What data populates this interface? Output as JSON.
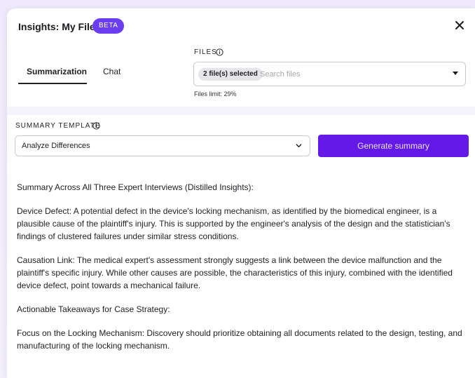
{
  "header": {
    "title": "Insights: My Files",
    "badge": "BETA",
    "close_icon": "close-icon"
  },
  "tabs": [
    {
      "label": "Summarization",
      "active": true
    },
    {
      "label": "Chat",
      "active": false
    }
  ],
  "files": {
    "label": "FILES",
    "selected_chip": "2 file(s) selected",
    "placeholder": "Search files",
    "limit_text": "Files limit: 29%",
    "limit_percent": 29
  },
  "template": {
    "label": "SUMMARY TEMPLATE",
    "selected": "Analyze Differences"
  },
  "actions": {
    "generate_label": "Generate summary"
  },
  "summary": {
    "paragraphs": [
      "Summary Across All Three Expert Interviews (Distilled Insights):",
      "Device Defect: A potential defect in the device's locking mechanism, as identified by the biomedical engineer, is a plausible cause of the plaintiff's injury. This is supported by the engineer's analysis of the design and the statistician's findings of clustered failures under similar stress conditions.",
      "Causation Link: The medical expert's assessment strongly suggests a link between the device malfunction and the plaintiff's specific injury. While other causes are possible, the characteristics of this injury, combined with the identified device defect, point towards a mechanical failure.",
      "Actionable Takeaways for Case Strategy:",
      "Focus on the Locking Mechanism: Discovery should prioritize obtaining all documents related to the design, testing, and manufacturing of the locking mechanism."
    ]
  },
  "colors": {
    "accent": "#6519e6",
    "badge": "#6b3df0",
    "background": "#efe9fb"
  }
}
